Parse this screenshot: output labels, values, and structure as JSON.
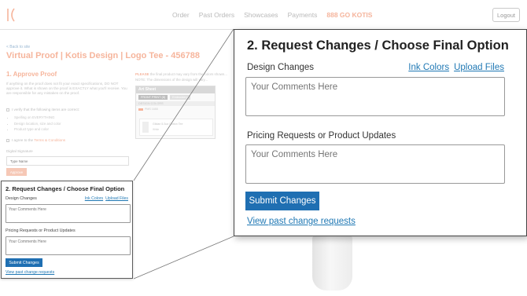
{
  "nav": {
    "logo_icon": "kotis-logo-icon",
    "links": [
      "Order",
      "Past Orders",
      "Showcases",
      "Payments"
    ],
    "phone": "888 GO KOTIS",
    "logout_label": "Logout"
  },
  "background": {
    "back_link": "< Back to site",
    "page_title": "Virtual Proof | Kotis Design | Logo Tee - 456788",
    "step1_title": "1. Approve Proof",
    "step1_text": "If anything on the proof does not fit your exact specifications, DO NOT approve it. What is shown on the proof is EXACTLY what you'll receive. You are responsible for any mistakes on the proof.",
    "verify_label": "I verify that the following items are correct:",
    "verify_items": [
      "Spelling on EVERYTHING",
      "Design location, size and color",
      "Product type and color"
    ],
    "agree_prefix": "I agree to the",
    "agree_link": "Terms & Conditions",
    "signature_label": "Digital Signature",
    "signature_placeholder": "Type Name",
    "approve_label": "Approve",
    "proof_note_label": "PLEASE",
    "proof_note_line1": "the final product may vary from the colors shown...",
    "proof_note_line2": "NOTE: The dimensions of the design will vary...",
    "art_sheet": {
      "title": "Art Sheet",
      "tabs": [
        "FRONT PRINT (8)",
        "Embroidery"
      ],
      "colors_label": "DESIGN COLORS",
      "pms": "PMS 1655",
      "product_name": "Gildan 5.3oz Cotton Tee",
      "product_color": "White"
    }
  },
  "panel": {
    "title": "2. Request Changes / Choose Final Option",
    "design_changes_label": "Design Changes",
    "ink_colors_link": "Ink Colors",
    "upload_files_link": "Upload Files",
    "comments_placeholder": "Your Comments Here",
    "pricing_label": "Pricing Requests or Product Updates",
    "submit_label": "Submit Changes",
    "view_past_link": "View past change requests"
  },
  "colors": {
    "accent_orange": "#f6b59c",
    "primary_button": "#1f6fb2",
    "link_blue": "#1f78b4"
  }
}
